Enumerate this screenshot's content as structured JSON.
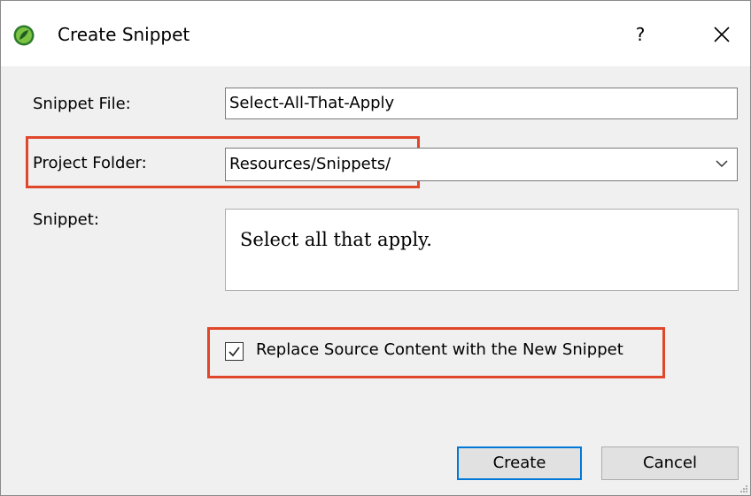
{
  "dialog": {
    "title": "Create Snippet",
    "help_label": "?",
    "icon": "flare-app-icon"
  },
  "form": {
    "snippet_file_label": "Snippet File:",
    "snippet_file_value": "Select-All-That-Apply",
    "project_folder_label": "Project Folder:",
    "project_folder_value": "Resources/Snippets/",
    "snippet_label": "Snippet:",
    "snippet_text": "Select all that apply.",
    "replace_checkbox_label": "Replace Source Content with the New Snippet",
    "replace_checked": true
  },
  "buttons": {
    "create": "Create",
    "cancel": "Cancel"
  },
  "colors": {
    "highlight": "#e0462a",
    "default_button_border": "#0078d7"
  }
}
